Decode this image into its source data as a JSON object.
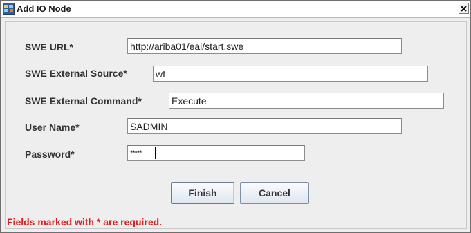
{
  "window": {
    "title": "Add IO Node",
    "close_glyph": "X",
    "icon": "app-window-icon"
  },
  "form": {
    "swe_url": {
      "label": "SWE URL*",
      "value": "http://ariba01/eai/start.swe"
    },
    "swe_external_source": {
      "label": "SWE External Source*",
      "value": "wf"
    },
    "swe_external_command": {
      "label": "SWE External Command*",
      "value": "Execute"
    },
    "user_name": {
      "label": "User Name*",
      "value": "SADMIN"
    },
    "password": {
      "label": "Password*",
      "value": "*****"
    }
  },
  "buttons": {
    "finish": "Finish",
    "cancel": "Cancel"
  },
  "footer": {
    "required_note": "Fields marked with * are required."
  },
  "colors": {
    "note_red": "#e21d1d",
    "dialog_bg": "#eeeeee",
    "button_border": "#7f8fa5"
  }
}
